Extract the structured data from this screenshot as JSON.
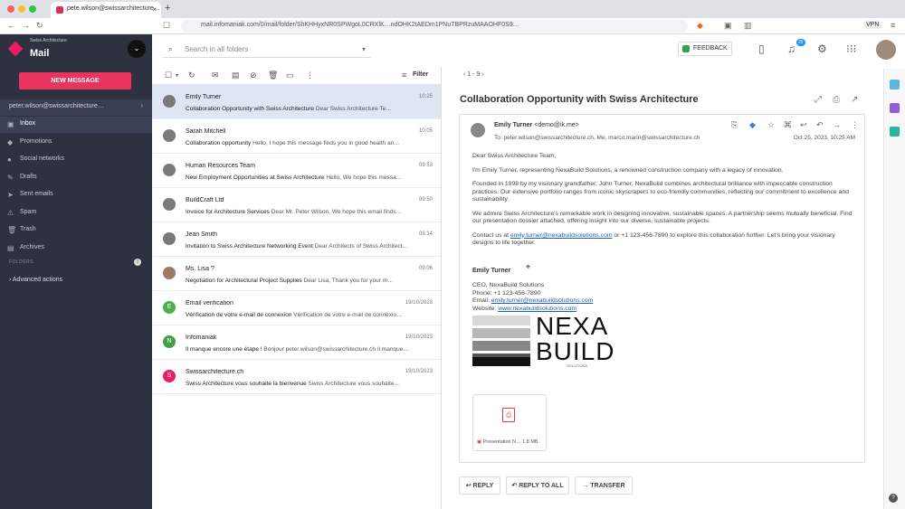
{
  "browser": {
    "tab_title": "pete.wilson@swissarchitecture…",
    "url": "mail.infomaniak.com/0/mail/folder/ShKHHyxNR0SPWgoL0CRXlK…ndOHK2tAEDm1PNuTBPRzuMAAOHF0S9…",
    "vpn_label": "VPN"
  },
  "sidebar": {
    "brand_line1": "Swiss Architecture",
    "brand_name": "Mail",
    "new_message_label": "NEW MESSAGE",
    "account": "peter.wilson@swissarchitecture…",
    "folders": [
      {
        "label": "Inbox",
        "icon": "inbox-icon",
        "glyph": "▣",
        "active": true
      },
      {
        "label": "Promotions",
        "icon": "tag-icon",
        "glyph": "◆",
        "active": false
      },
      {
        "label": "Social networks",
        "icon": "people-icon",
        "glyph": "●",
        "active": false
      },
      {
        "label": "Drafts",
        "icon": "pencil-icon",
        "glyph": "✎",
        "active": false
      },
      {
        "label": "Sent emails",
        "icon": "send-icon",
        "glyph": "➤",
        "active": false
      },
      {
        "label": "Spam",
        "icon": "warning-icon",
        "glyph": "⚠",
        "active": false
      },
      {
        "label": "Trash",
        "icon": "trash-icon",
        "glyph": "🗑",
        "active": false
      },
      {
        "label": "Archives",
        "icon": "archive-icon",
        "glyph": "▤",
        "active": false
      }
    ],
    "folders_heading": "FOLDERS",
    "advanced_actions": "Advanced actions"
  },
  "header": {
    "search_placeholder": "Search in all folders",
    "feedback_label": "FEEDBACK",
    "notification_count": "25"
  },
  "list": {
    "filter_label": "Filter",
    "pager": "1 - 9",
    "rows": [
      {
        "sender": "Emily Turner",
        "date": "10:25",
        "subject": "Collaboration Opportunity with Swiss Architecture",
        "preview": "Dear Swiss Architecture Te…",
        "avatar_color": "#7a7a7a",
        "initial": "",
        "selected": true
      },
      {
        "sender": "Sarah Mitchell",
        "date": "10:05",
        "subject": "Collaboration opportunity",
        "preview": "Hello, I hope this message finds you in good health an…",
        "avatar_color": "#7a7a7a",
        "initial": "",
        "selected": false
      },
      {
        "sender": "Human Resources Team",
        "date": "09:53",
        "subject": "New Employment Opportunities at Swiss Architecture",
        "preview": "Hello, We hope this messa…",
        "avatar_color": "#7a7a7a",
        "initial": "",
        "selected": false
      },
      {
        "sender": "BuildCraft Ltd",
        "date": "09:50",
        "subject": "Invoice for Architecture Services",
        "preview": "Dear Mr. Peter Wilson, We hope this email finds…",
        "avatar_color": "#7a7a7a",
        "initial": "",
        "selected": false
      },
      {
        "sender": "Jean Smith",
        "date": "09:14",
        "subject": "Invitation to Swiss Architecture Networking Event",
        "preview": "Dear Architects of Swiss Architect…",
        "avatar_color": "#7a7a7a",
        "initial": "",
        "selected": false
      },
      {
        "sender": "Ms. Lisa ?",
        "date": "09:06",
        "subject": "Negotiation for Architectural Project Supplies",
        "preview": "Dear Lisa, Thank you for your m…",
        "avatar_color": "#9c7a66",
        "initial": "",
        "selected": false
      },
      {
        "sender": "Email verification",
        "date": "19/10/2023",
        "subject": "Vérification de votre e-mail de connexion",
        "preview": "Vérification de votre e-mail de connexio…",
        "avatar_color": "#4caf50",
        "initial": "E",
        "selected": false
      },
      {
        "sender": "Infomaniak",
        "date": "19/10/2023",
        "subject": "Il manque encore une étape !",
        "preview": "Bonjour peter.wilson@swissarchitecture.ch Il manque…",
        "avatar_color": "#43a047",
        "initial": "N",
        "selected": false
      },
      {
        "sender": "Swissarchitecture.ch",
        "date": "19/10/2023",
        "subject": "Swiss Architecture vous souhaite la bienvenue",
        "preview": "Swiss Architecture vous souhaite…",
        "avatar_color": "#e91e63",
        "initial": "S",
        "selected": false
      }
    ]
  },
  "reader": {
    "subject": "Collaboration Opportunity with Swiss Architecture",
    "from_name": "Emily Turner",
    "from_email": "<demo@ik.me>",
    "to": "To: peter.wilson@swissarchitecture.ch, Me, marco.marin@swissarchitecture.ch",
    "date": "Oct 25, 2023, 10:25 AM",
    "greeting": "Dear Swiss Architecture Team,",
    "p1": "I'm Emily Turner, representing NexaBuild Solutions, a renowned construction company with a legacy of innovation.",
    "p2": "Founded in 1998 by my visionary grandfather, John Turner, NexaBuild combines architectural brilliance with impeccable construction practices. Our extensive portfolio ranges from iconic skyscrapers to eco-friendly communities, reflecting our commitment to excellence and sustainability.",
    "p3": "We admire Swiss Architecture's remarkable work in designing innovative, sustainable spaces. A partnership seems mutually beneficial. Find our presentation dossier attached, offering insight into our diverse, sustainable projects.",
    "p4_prefix": "Contact us at",
    "p4_email": "emily.turner@nexabuildsolutions.com",
    "p4_suffix": "or +1 123-456-7890 to explore this collaboration further. Let's bring your visionary designs to life together.",
    "sig_name": "Emily Turner",
    "sig_title": "CEO, NexaBuild Solutions",
    "sig_phone": "Phone: +1 123-456-7890",
    "sig_email_label": "Email:",
    "sig_email": "emily.turner@nexabuildsolutions.com",
    "sig_web_label": "Website:",
    "sig_web": "www.nexabuildsolutions.com",
    "logo_line1": "NEXA",
    "logo_line2": "BUILD",
    "logo_sub": "SOLUTIONS",
    "attachment_name": "Presentation N…",
    "attachment_size": "1.8 MB",
    "reply_label": "REPLY",
    "reply_all_label": "REPLY TO ALL",
    "transfer_label": "TRANSFER"
  }
}
